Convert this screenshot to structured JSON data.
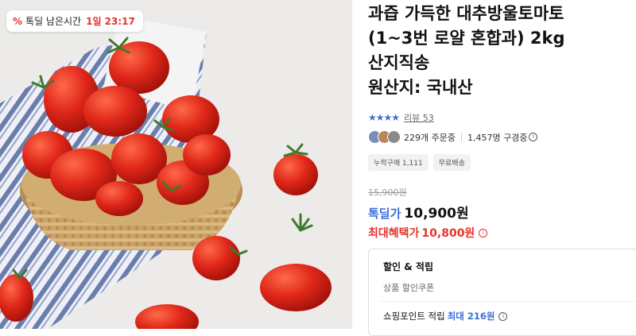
{
  "badge": {
    "icon": "percent-icon",
    "label": "톡딜 남은시간",
    "time": "1일 23:17"
  },
  "product": {
    "title_lines": [
      "과즙 가득한 대추방울토마토",
      "(1~3번 로얄 혼합과) 2kg",
      "산지직송",
      "원산지: 국내산"
    ]
  },
  "rating": {
    "stars": "★★★★",
    "review_label": "리뷰 53"
  },
  "orders": {
    "ordering": "229개 주문중",
    "subscribers": "1,457명 구경중"
  },
  "chips": [
    "누적구매 1,111",
    "무료배송"
  ],
  "price": {
    "original": "15,900원",
    "deal_label": "톡딜가",
    "deal_price": "10,900원",
    "max_label": "최대혜택가",
    "max_price": "10,800원"
  },
  "benefits": {
    "title": "할인 & 적립",
    "subtitle": "상품 할인쿠폰",
    "point_label": "쇼핑포인트 적립",
    "point_max": "최대 216원"
  },
  "colors": {
    "accent_blue": "#3a6fd8",
    "accent_red": "#e8322b"
  }
}
